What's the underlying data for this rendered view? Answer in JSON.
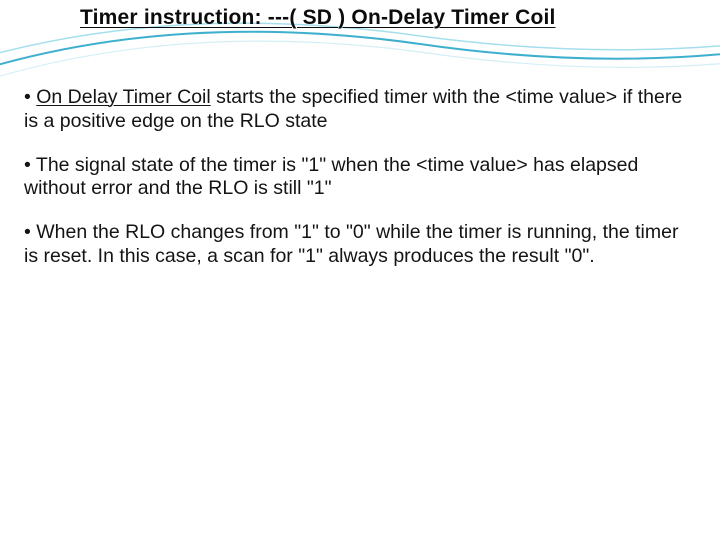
{
  "slide": {
    "title": "Timer instruction: ---( SD ) On-Delay Timer Coil",
    "bullets": {
      "b1_lead": "On Delay Timer Coil",
      "b1_rest": " starts the specified timer with the <time value> if there is a positive edge on the RLO state",
      "b2": "The signal state of the timer is \"1\" when the <time value> has elapsed without error and the RLO is still \"1\"",
      "b3": "When the RLO changes from \"1\" to \"0\" while the timer is running, the timer is reset. In this case, a scan for \"1\" always produces the result \"0\"."
    }
  }
}
